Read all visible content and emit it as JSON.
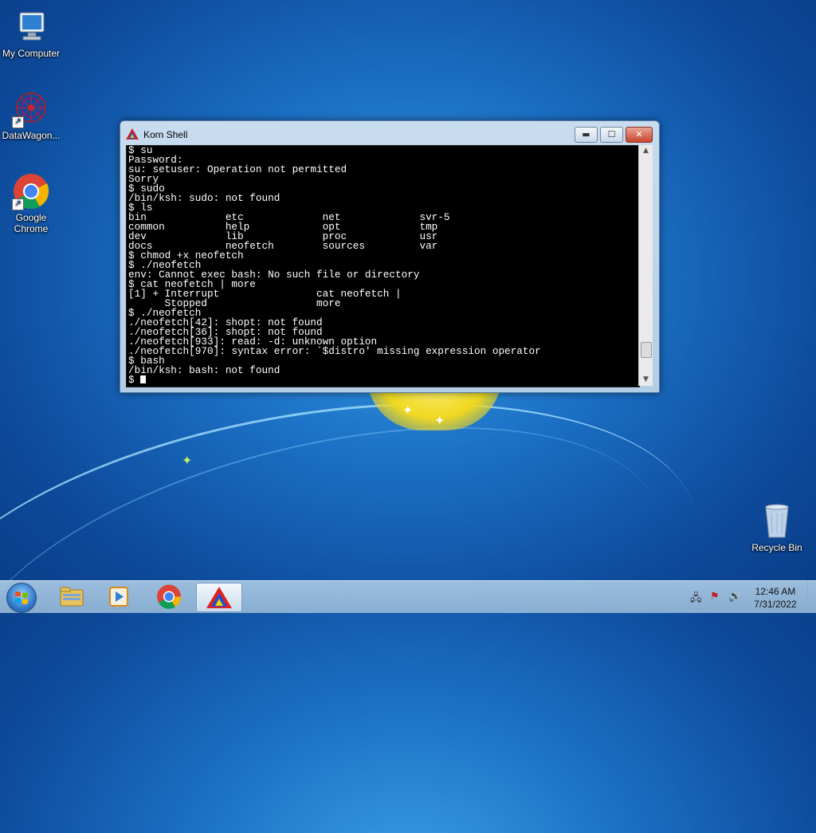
{
  "desktop": {
    "icons": [
      {
        "label": "My Computer"
      },
      {
        "label": "DataWagon..."
      },
      {
        "label": "Google Chrome"
      },
      {
        "label": "Recycle Bin"
      }
    ]
  },
  "window": {
    "title": "Korn Shell",
    "controls": {
      "minimize": "▬",
      "maximize": "☐",
      "close": "✕"
    },
    "terminal_lines": [
      "$ su",
      "Password:",
      "su: setuser: Operation not permitted",
      "Sorry",
      "$ sudo",
      "/bin/ksh: sudo: not found",
      "$ ls",
      "bin             etc             net             svr-5",
      "common          help            opt             tmp",
      "dev             lib             proc            usr",
      "docs            neofetch        sources         var",
      "$ chmod +x neofetch",
      "$ ./neofetch",
      "env: Cannot exec bash: No such file or directory",
      "$ cat neofetch | more",
      "[1] + Interrupt                cat neofetch |",
      "      Stopped                  more",
      "$ ./neofetch",
      "./neofetch[42]: shopt: not found",
      "./neofetch[36]: shopt: not found",
      "./neofetch[933]: read: -d: unknown option",
      "./neofetch[970]: syntax error: `$distro' missing expression operator",
      "$ bash",
      "/bin/ksh: bash: not found"
    ],
    "prompt": "$ ",
    "scroll_position": 0.92
  },
  "taskbar": {
    "apps": [
      "explorer",
      "media-player",
      "chrome",
      "korn-shell"
    ],
    "clock_time": "12:46 AM",
    "clock_date": "7/31/2022"
  }
}
